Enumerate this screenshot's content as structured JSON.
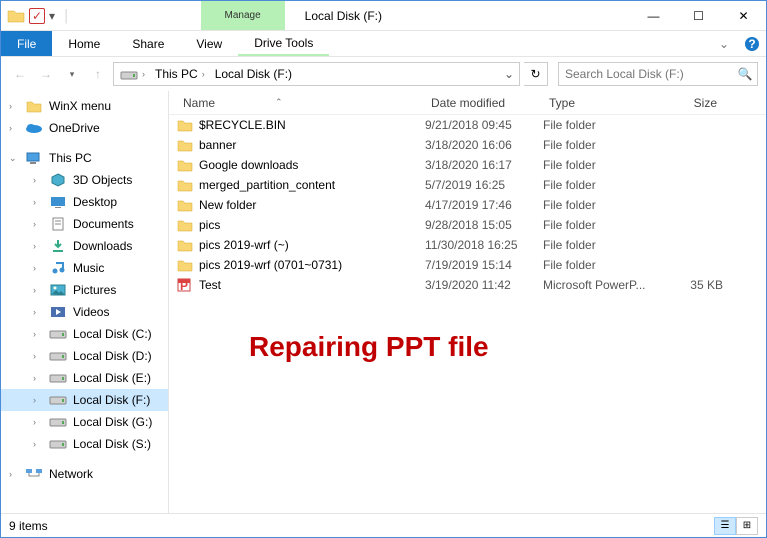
{
  "window": {
    "title": "Local Disk (F:)",
    "contextual_tab_group": "Manage",
    "contextual_tab": "Drive Tools"
  },
  "ribbon_tabs": [
    "File",
    "Home",
    "Share",
    "View"
  ],
  "nav_buttons": {
    "back_enabled": false,
    "forward_enabled": false
  },
  "breadcrumbs": [
    "This PC",
    "Local Disk (F:)"
  ],
  "search_placeholder": "Search Local Disk (F:)",
  "navpane": {
    "top": [
      {
        "label": "WinX menu",
        "type": "folder"
      },
      {
        "label": "OneDrive",
        "type": "onedrive"
      }
    ],
    "thispc_label": "This PC",
    "thispc_children": [
      {
        "label": "3D Objects",
        "type": "3d"
      },
      {
        "label": "Desktop",
        "type": "desktop"
      },
      {
        "label": "Documents",
        "type": "docs"
      },
      {
        "label": "Downloads",
        "type": "downloads"
      },
      {
        "label": "Music",
        "type": "music"
      },
      {
        "label": "Pictures",
        "type": "pictures"
      },
      {
        "label": "Videos",
        "type": "videos"
      },
      {
        "label": "Local Disk (C:)",
        "type": "disk"
      },
      {
        "label": "Local Disk (D:)",
        "type": "disk"
      },
      {
        "label": "Local Disk (E:)",
        "type": "disk"
      },
      {
        "label": "Local Disk (F:)",
        "type": "disk",
        "selected": true
      },
      {
        "label": "Local Disk (G:)",
        "type": "disk"
      },
      {
        "label": "Local Disk (S:)",
        "type": "disk"
      }
    ],
    "network_label": "Network"
  },
  "columns": {
    "name": "Name",
    "date": "Date modified",
    "type": "Type",
    "size": "Size",
    "sort": "name_asc"
  },
  "files": [
    {
      "name": "$RECYCLE.BIN",
      "date": "9/21/2018 09:45",
      "type": "File folder",
      "size": "",
      "kind": "folder"
    },
    {
      "name": "banner",
      "date": "3/18/2020 16:06",
      "type": "File folder",
      "size": "",
      "kind": "folder"
    },
    {
      "name": "Google downloads",
      "date": "3/18/2020 16:17",
      "type": "File folder",
      "size": "",
      "kind": "folder"
    },
    {
      "name": "merged_partition_content",
      "date": "5/7/2019 16:25",
      "type": "File folder",
      "size": "",
      "kind": "folder"
    },
    {
      "name": "New folder",
      "date": "4/17/2019 17:46",
      "type": "File folder",
      "size": "",
      "kind": "folder"
    },
    {
      "name": "pics",
      "date": "9/28/2018 15:05",
      "type": "File folder",
      "size": "",
      "kind": "folder"
    },
    {
      "name": "pics 2019-wrf (~)",
      "date": "11/30/2018 16:25",
      "type": "File folder",
      "size": "",
      "kind": "folder"
    },
    {
      "name": "pics 2019-wrf (0701~0731)",
      "date": "7/19/2019 15:14",
      "type": "File folder",
      "size": "",
      "kind": "folder"
    },
    {
      "name": "Test",
      "date": "3/19/2020 11:42",
      "type": "Microsoft PowerP...",
      "size": "35 KB",
      "kind": "ppt"
    }
  ],
  "status_text": "9 items",
  "overlay": "Repairing PPT file"
}
